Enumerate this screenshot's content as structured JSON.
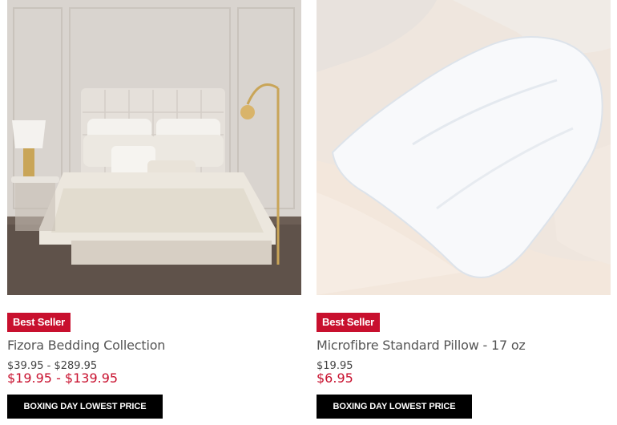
{
  "products": [
    {
      "badge": "Best Seller",
      "title": "Fizora Bedding Collection",
      "original_price": "$39.95 - $289.95",
      "sale_price": "$19.95 - $139.95",
      "promo_label": "BOXING DAY LOWEST PRICE",
      "image_icon": "bedroom-photo"
    },
    {
      "badge": "Best Seller",
      "title": "Microfibre Standard Pillow - 17 oz",
      "original_price": "$19.95",
      "sale_price": "$6.95",
      "promo_label": "BOXING DAY LOWEST PRICE",
      "image_icon": "pillow-photo"
    }
  ],
  "colors": {
    "badge_bg": "#c8102e",
    "sale_price": "#c8102e",
    "promo_bg": "#000000"
  }
}
